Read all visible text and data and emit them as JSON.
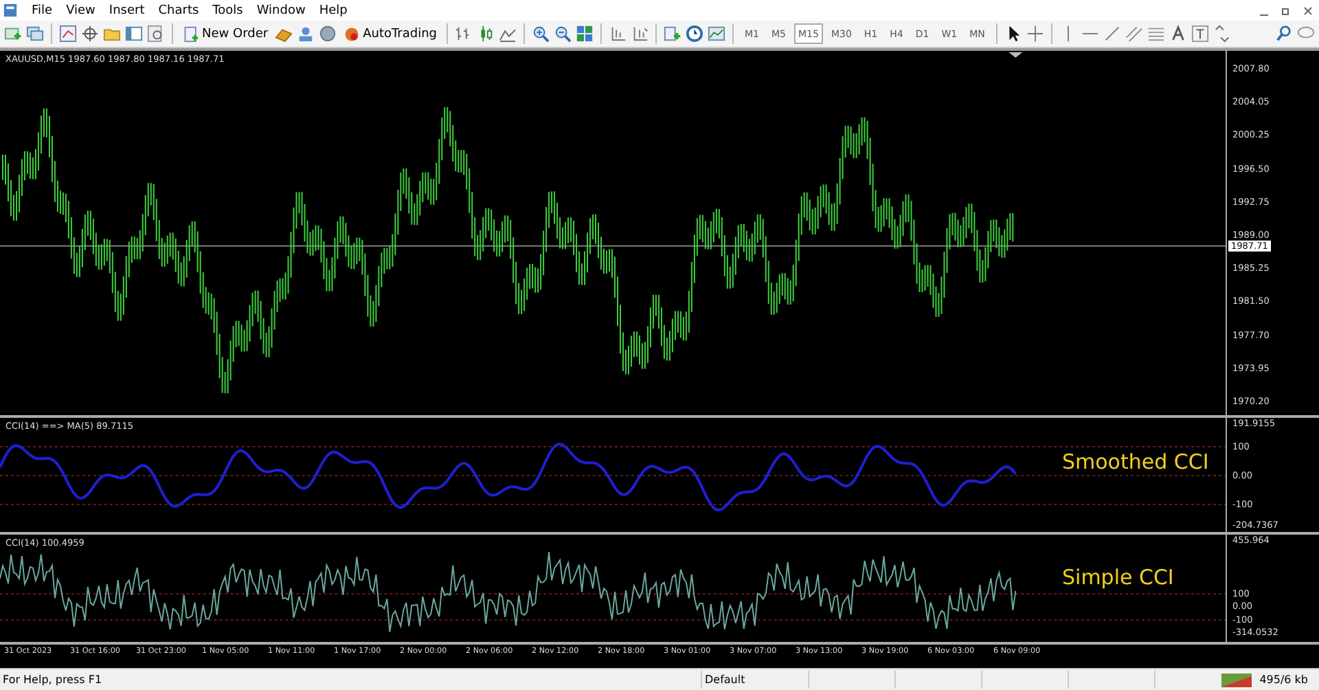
{
  "menu": [
    "File",
    "View",
    "Insert",
    "Charts",
    "Tools",
    "Window",
    "Help"
  ],
  "toolbar": {
    "new_order": "New Order",
    "autotrading": "AutoTrading",
    "timeframes": [
      {
        "label": "M1",
        "selected": false
      },
      {
        "label": "M5",
        "selected": false
      },
      {
        "label": "M15",
        "selected": true
      },
      {
        "label": "M30",
        "selected": false
      },
      {
        "label": "H1",
        "selected": false
      },
      {
        "label": "H4",
        "selected": false
      },
      {
        "label": "D1",
        "selected": false
      },
      {
        "label": "W1",
        "selected": false
      },
      {
        "label": "MN",
        "selected": false
      }
    ]
  },
  "chart": {
    "header": "XAUUSD,M15  1987.60 1987.80 1987.16 1987.71",
    "price_axis": [
      "2007.80",
      "2004.05",
      "2000.25",
      "1996.50",
      "1992.75",
      "1989.00",
      "1985.25",
      "1981.50",
      "1977.70",
      "1973.95",
      "1970.20"
    ],
    "current_price": "1987.71",
    "indicators": [
      {
        "header": "CCI(14) ==> MA(5) 89.7115",
        "axis": [
          "191.9155",
          "100",
          "0.00",
          "-100",
          "-204.7367"
        ],
        "annotation": "Smoothed CCI",
        "kind": "smoothed"
      },
      {
        "header": "CCI(14) 100.4959",
        "axis": [
          "455.964",
          "100",
          "0.00",
          "-100",
          "-314.0532"
        ],
        "annotation": "Simple CCI",
        "kind": "simple"
      }
    ],
    "time_axis": [
      "31 Oct 2023",
      "31 Oct 16:00",
      "31 Oct 23:00",
      "1 Nov 05:00",
      "1 Nov 11:00",
      "1 Nov 17:00",
      "2 Nov 00:00",
      "2 Nov 06:00",
      "2 Nov 12:00",
      "2 Nov 18:00",
      "3 Nov 01:00",
      "3 Nov 07:00",
      "3 Nov 13:00",
      "3 Nov 19:00",
      "6 Nov 03:00",
      "6 Nov 09:00"
    ]
  },
  "status_bar": {
    "help": "For Help, press F1",
    "profile": "Default",
    "traffic": "495/6 kb"
  }
}
